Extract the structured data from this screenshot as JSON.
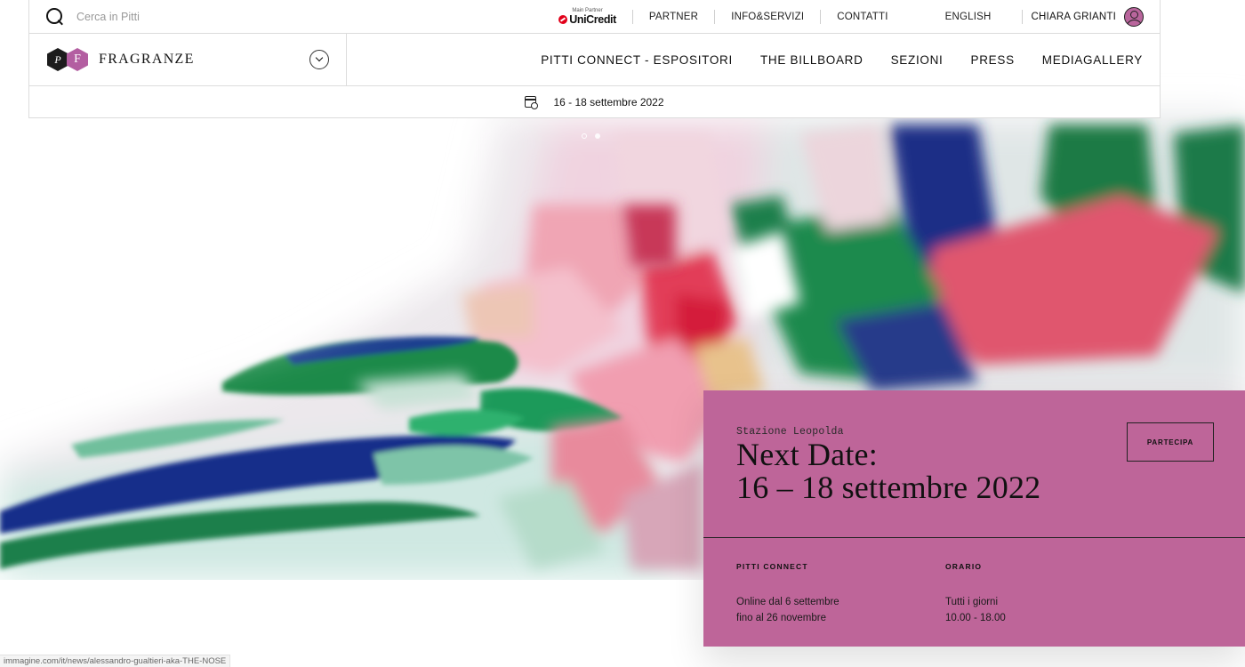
{
  "search": {
    "placeholder": "Cerca in Pitti"
  },
  "partner": {
    "caption": "Main Partner",
    "name": "UniCredit"
  },
  "top_links": [
    "PARTNER",
    "INFO&SERVIZI",
    "CONTATTI"
  ],
  "language": "ENGLISH",
  "user": {
    "name": "CHIARA GRIANTI"
  },
  "brand": {
    "logo_letters": [
      "P",
      "F"
    ],
    "name": "FRAGRANZE"
  },
  "nav": [
    "PITTI CONNECT - ESPOSITORI",
    "THE BILLBOARD",
    "SEZIONI",
    "PRESS",
    "MEDIAGALLERY"
  ],
  "date_bar": {
    "text": "16 - 18 settembre 2022"
  },
  "event": {
    "venue": "Stazione Leopolda",
    "title_line1": "Next Date:",
    "title_line2": "16 – 18 settembre 2022",
    "cta": "PARTECIPA",
    "connect": {
      "heading": "PITTI CONNECT",
      "line1": "Online dal 6 settembre",
      "line2": "fino al 26 novembre"
    },
    "hours": {
      "heading": "ORARIO",
      "line1": "Tutti i giorni",
      "line2": "10.00 - 18.00"
    }
  },
  "status_url": "immagine.com/it/news/alessandro-gualtieri-aka-THE-NOSE",
  "colors": {
    "accent": "#be6599",
    "logo_pink": "#b35ea1"
  }
}
